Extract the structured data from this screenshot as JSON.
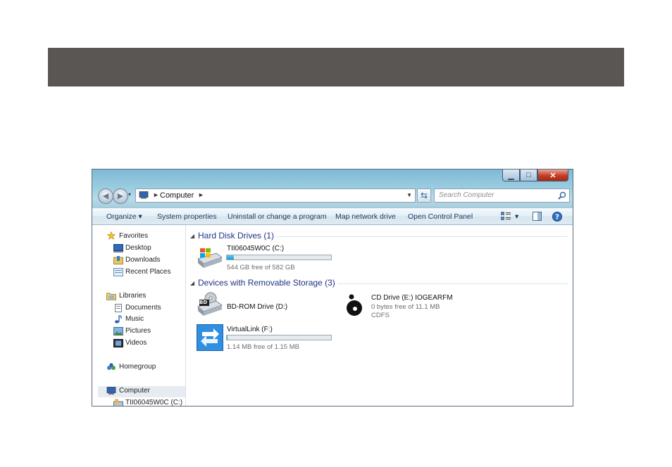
{
  "window": {
    "controls": {
      "minimize": "▁",
      "maximize": "□",
      "close": "✕"
    }
  },
  "address_bar": {
    "location": "Computer",
    "search_placeholder": "Search Computer"
  },
  "toolbar": {
    "organize": "Organize ▾",
    "system_properties": "System properties",
    "uninstall": "Uninstall or change a program",
    "map_network": "Map network drive",
    "open_control_panel": "Open Control Panel",
    "view_dropdown": "▾"
  },
  "nav_pane": {
    "favorites": {
      "label": "Favorites",
      "items": [
        "Desktop",
        "Downloads",
        "Recent Places"
      ]
    },
    "libraries": {
      "label": "Libraries",
      "items": [
        "Documents",
        "Music",
        "Pictures",
        "Videos"
      ]
    },
    "homegroup": "Homegroup",
    "computer": {
      "label": "Computer",
      "items": [
        "TII06045W0C (C:)"
      ]
    }
  },
  "groups": [
    {
      "title": "Hard Disk Drives (1)",
      "drives": [
        {
          "name": "TII06045W0C (C:)",
          "detail": "544 GB free of 582 GB",
          "used_fraction": 0.065,
          "icon": "windows-hard-drive-icon"
        }
      ]
    },
    {
      "title": "Devices with Removable Storage (3)",
      "drives": [
        {
          "name": "BD-ROM Drive (D:)",
          "icon": "bd-rom-drive-icon",
          "badge": "BD"
        },
        {
          "name": "CD Drive (E:) IOGEARFM",
          "detail": "0 bytes free of 11.1 MB",
          "detail2": "CDFS",
          "icon": "iogear-disc-icon"
        },
        {
          "name": "VirtualLink (F:)",
          "detail": "1.14 MB free of 1.15 MB",
          "used_fraction": 0.01,
          "icon": "virtuallink-drive-icon"
        }
      ]
    }
  ],
  "colors": {
    "banner": "#595653",
    "group_heading": "#1e3287",
    "bar_fill": "#1c99d6"
  }
}
